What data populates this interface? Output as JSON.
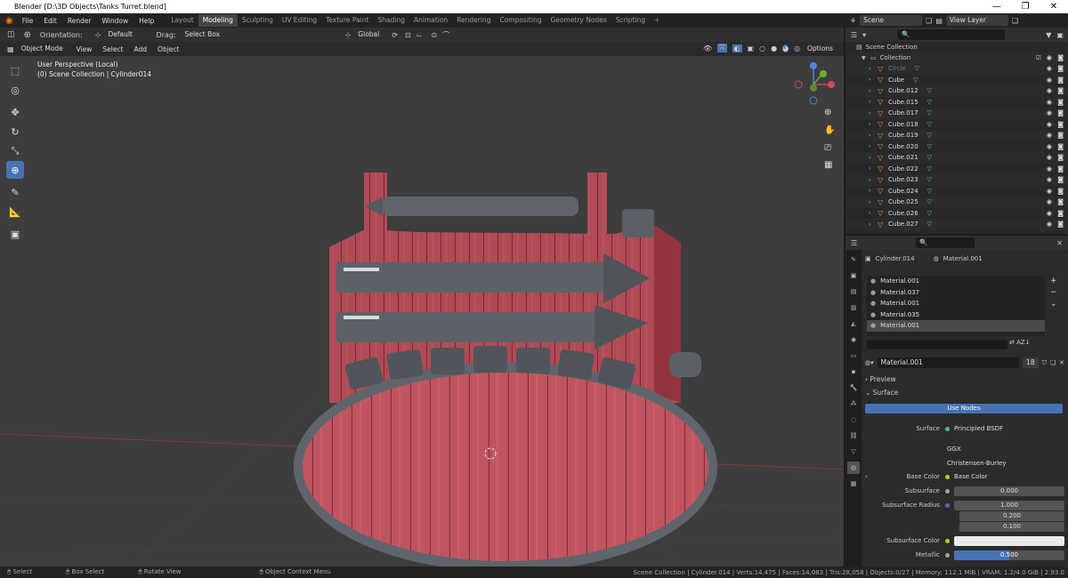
{
  "window": {
    "title": "Blender [D:\\3D Objects\\Tanks Turret.blend]",
    "buttons": [
      "—",
      "❐",
      "✕"
    ]
  },
  "menu": [
    "File",
    "Edit",
    "Render",
    "Window",
    "Help"
  ],
  "workspaces": [
    "Layout",
    "Modeling",
    "Sculpting",
    "UV Editing",
    "Texture Paint",
    "Shading",
    "Animation",
    "Rendering",
    "Compositing",
    "Geometry Nodes",
    "Scripting"
  ],
  "active_workspace": "Modeling",
  "scene": {
    "scene_label": "Scene",
    "view_layer_label": "View Layer"
  },
  "tool_header": {
    "orientation_label": "Orientation:",
    "orientation_value": "Default",
    "drag_label": "Drag:",
    "drag_value": "Select Box",
    "transform_orientation": "Global"
  },
  "viewport_header": {
    "mode": "Object Mode",
    "menus": [
      "View",
      "Select",
      "Add",
      "Object"
    ],
    "options": "Options"
  },
  "viewport": {
    "perspective": "User Perspective (Local)",
    "collection": "(0) Scene Collection | Cylinder014"
  },
  "outliner": {
    "root": "Scene Collection",
    "collection": "Collection",
    "items": [
      "Circle",
      "Cube",
      "Cube.012",
      "Cube.015",
      "Cube.017",
      "Cube.018",
      "Cube.019",
      "Cube.020",
      "Cube.021",
      "Cube.022",
      "Cube.023",
      "Cube.024",
      "Cube.025",
      "Cube.026",
      "Cube.027"
    ]
  },
  "properties": {
    "object": "Cylinder.014",
    "material_header": "Material.001",
    "slots": [
      "Material.001",
      "Material.037",
      "Material.001",
      "Material.035",
      "Material.001"
    ],
    "active_slot_index": 4,
    "material_name": "Material.001",
    "user_count": "18",
    "preview_label": "Preview",
    "surface_label": "Surface",
    "use_nodes": "Use Nodes",
    "surface_field_label": "Surface",
    "surface_value": "Principled BSDF",
    "distribution": "GGX",
    "subsurface_method": "Christensen-Burley",
    "base_color_label": "Base Color",
    "base_color_value": "Base Color",
    "subsurface_label": "Subsurface",
    "subsurface_value": "0.000",
    "subsurface_radius_label": "Subsurface Radius",
    "radius": [
      "1.000",
      "0.200",
      "0.100"
    ],
    "subsurface_color_label": "Subsurface Color",
    "metallic_label": "Metallic",
    "metallic_value": "0.500"
  },
  "statusbar": {
    "select": "Select",
    "box_select": "Box Select",
    "rotate": "Rotate View",
    "context": "Object Context Menu",
    "stats": "Scene Collection | Cylinder.014 | Verts:14,475 | Faces:14,083 | Tris:28,058 | Objects:0/27 | Memory: 112.1 MiB | VRAM: 1.2/4.0 GiB | 2.93.0"
  },
  "colors": {
    "accent": "#4772b3",
    "crate": "#b3505a",
    "metal": "#5f656b"
  }
}
